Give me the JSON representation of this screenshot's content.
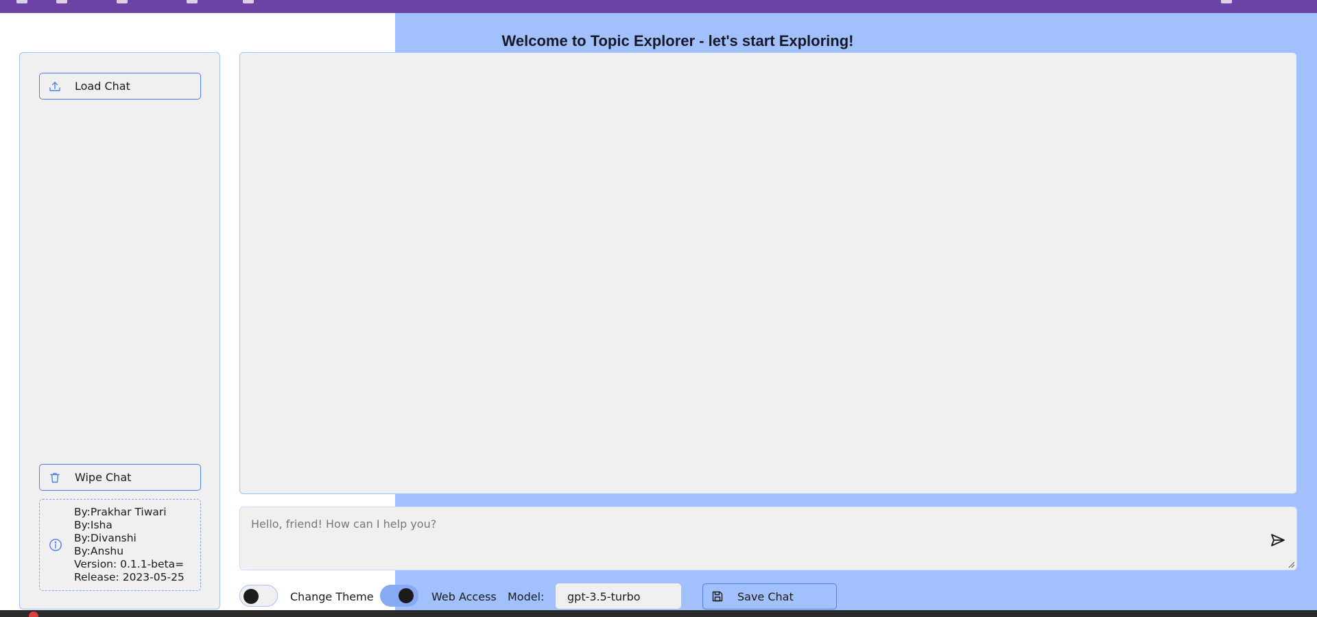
{
  "header": {
    "title": "Welcome to Topic Explorer - let's start Exploring!"
  },
  "sidebar": {
    "load_label": "Load Chat",
    "load_icon": "upload-icon",
    "wipe_label": "Wipe Chat",
    "wipe_icon": "trash-icon",
    "info_icon": "info-icon",
    "credits": [
      "By:Prakhar Tiwari",
      "By:Isha",
      "By:Divanshi",
      "By:Anshu",
      "Version: 0.1.1-beta=",
      "Release: 2023-05-25"
    ]
  },
  "prompt": {
    "placeholder": "Hello, friend! How can I help you?",
    "value": "",
    "send_icon": "send-icon"
  },
  "controls": {
    "theme_label": "Change Theme",
    "theme_on": false,
    "web_label": "Web Access",
    "web_on": true,
    "model_label": "Model:",
    "model_value": "gpt-3.5-turbo",
    "save_label": "Save Chat",
    "save_icon": "save-icon"
  },
  "colors": {
    "topbar": "#6c43a5",
    "accent_bg": "#a2c0fc",
    "accent_border": "#4d7ef0",
    "panel": "#f0f0f0"
  }
}
